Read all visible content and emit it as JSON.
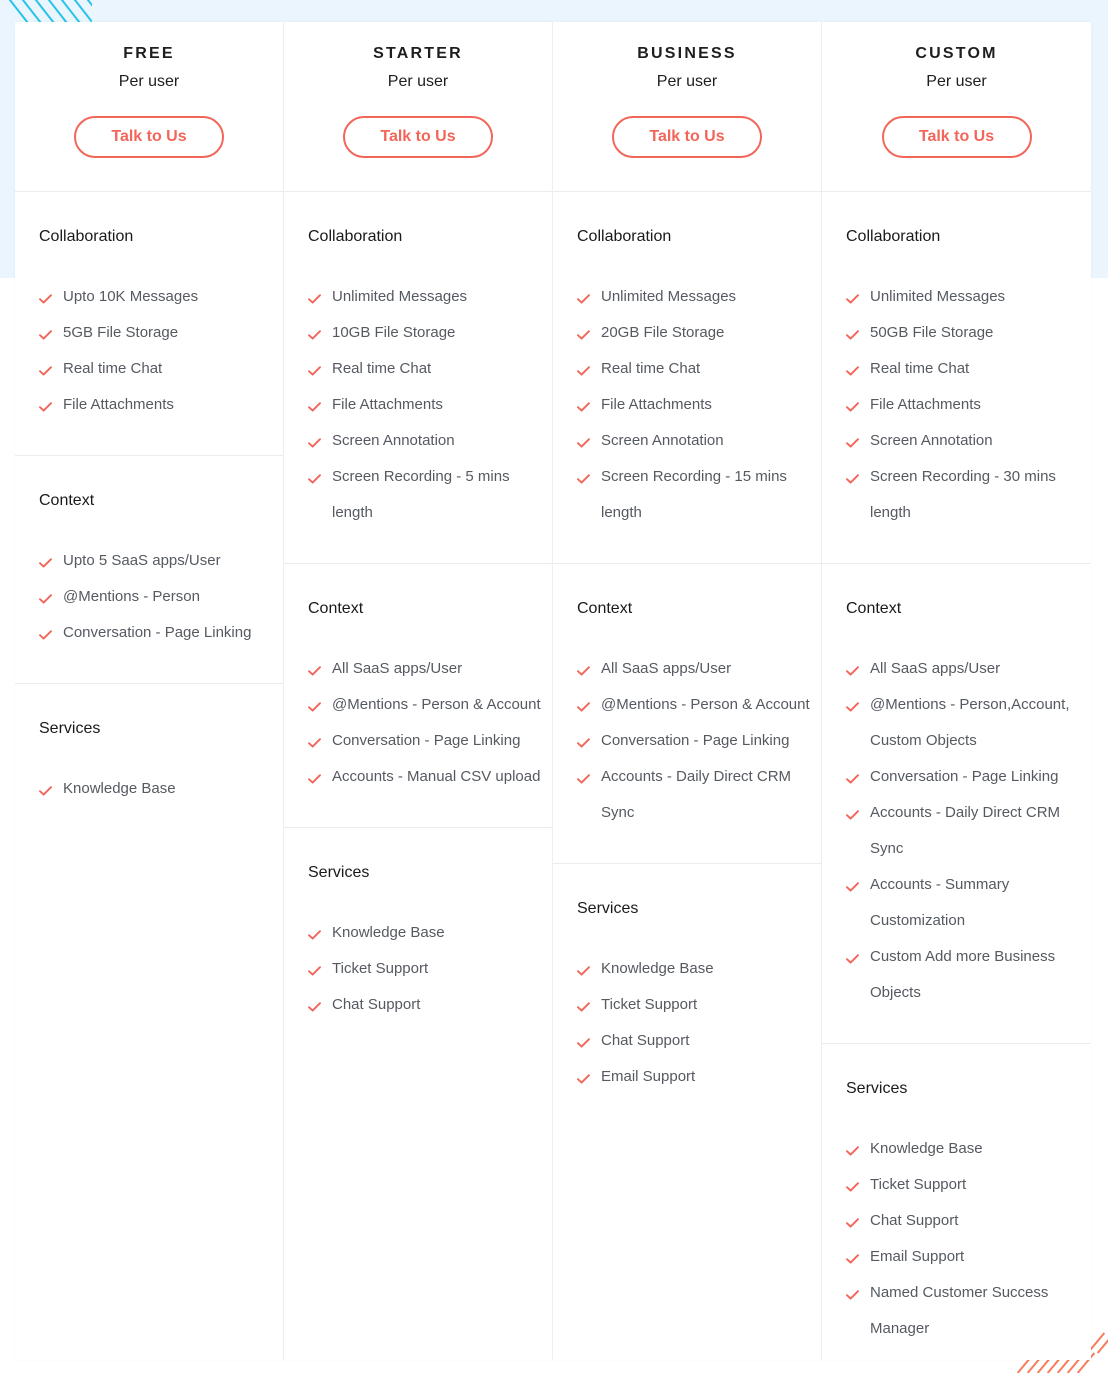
{
  "colors": {
    "accent": "#f2665a",
    "bg_band": "#eaf5fd",
    "stripe_blue": "#27c3ea",
    "stripe_orange": "#f47c58"
  },
  "plans": [
    {
      "name": "FREE",
      "per": "Per user",
      "cta": "Talk to Us",
      "sections": [
        {
          "title": "Collaboration",
          "features": [
            "Upto 10K Messages",
            "5GB File Storage",
            "Real time Chat",
            "File Attachments"
          ]
        },
        {
          "title": "Context",
          "features": [
            "Upto 5 SaaS apps/User",
            "@Mentions - Person",
            "Conversation - Page Linking"
          ]
        },
        {
          "title": "Services",
          "features": [
            "Knowledge Base"
          ]
        }
      ]
    },
    {
      "name": "STARTER",
      "per": "Per user",
      "cta": "Talk to Us",
      "sections": [
        {
          "title": "Collaboration",
          "features": [
            "Unlimited Messages",
            "10GB File Storage",
            "Real time Chat",
            "File Attachments",
            "Screen Annotation",
            "Screen Recording - 5 mins length"
          ]
        },
        {
          "title": "Context",
          "features": [
            "All SaaS apps/User",
            "@Mentions - Person & Account",
            "Conversation - Page Linking",
            "Accounts - Manual CSV upload"
          ]
        },
        {
          "title": "Services",
          "features": [
            "Knowledge Base",
            "Ticket Support",
            "Chat Support"
          ]
        }
      ]
    },
    {
      "name": "BUSINESS",
      "per": "Per user",
      "cta": "Talk to Us",
      "sections": [
        {
          "title": "Collaboration",
          "features": [
            "Unlimited Messages",
            "20GB File Storage",
            "Real time Chat",
            "File Attachments",
            "Screen Annotation",
            "Screen Recording - 15 mins length"
          ]
        },
        {
          "title": "Context",
          "features": [
            "All SaaS apps/User",
            "@Mentions - Person & Account",
            "Conversation - Page Linking",
            "Accounts - Daily Direct CRM Sync"
          ]
        },
        {
          "title": "Services",
          "features": [
            "Knowledge Base",
            "Ticket Support",
            "Chat Support",
            "Email Support"
          ]
        }
      ]
    },
    {
      "name": "CUSTOM",
      "per": "Per user",
      "cta": "Talk to Us",
      "sections": [
        {
          "title": "Collaboration",
          "features": [
            "Unlimited Messages",
            "50GB File Storage",
            "Real time Chat",
            "File Attachments",
            "Screen Annotation",
            "Screen Recording - 30 mins length"
          ]
        },
        {
          "title": "Context",
          "features": [
            "All SaaS apps/User",
            "@Mentions - Person,Account, Custom Objects",
            "Conversation - Page Linking",
            "Accounts - Daily Direct CRM Sync",
            "Accounts - Summary Customization",
            "Custom Add more Business Objects"
          ]
        },
        {
          "title": "Services",
          "features": [
            "Knowledge Base",
            "Ticket Support",
            "Chat Support",
            "Email Support",
            "Named Customer Success Manager"
          ]
        }
      ]
    }
  ]
}
